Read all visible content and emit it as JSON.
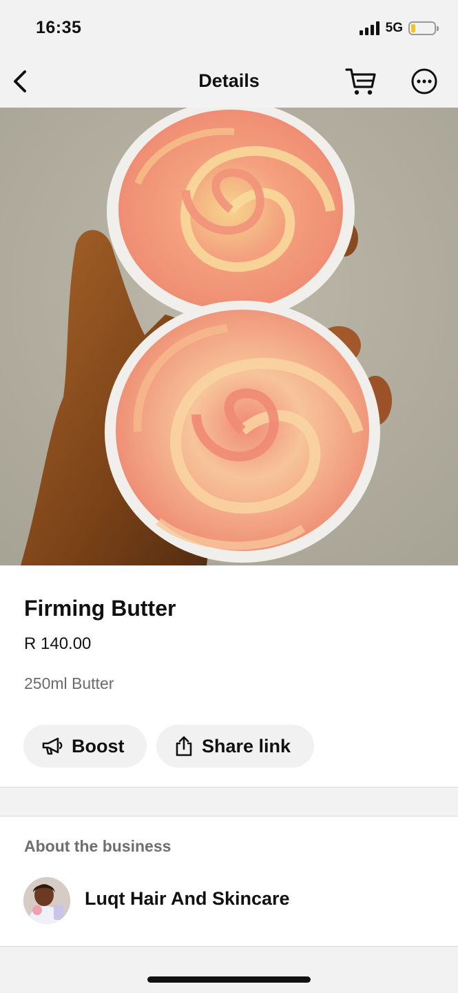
{
  "status_bar": {
    "time": "16:35",
    "network": "5G"
  },
  "nav": {
    "title": "Details"
  },
  "product": {
    "name": "Firming Butter",
    "price": "R 140.00",
    "description": "250ml Butter"
  },
  "actions": {
    "boost_label": "Boost",
    "share_label": "Share link"
  },
  "about": {
    "heading": "About the business",
    "business_name": "Luqt Hair And Skincare"
  },
  "icons": [
    "back-icon",
    "cart-icon",
    "more-icon",
    "megaphone-icon",
    "share-icon"
  ]
}
